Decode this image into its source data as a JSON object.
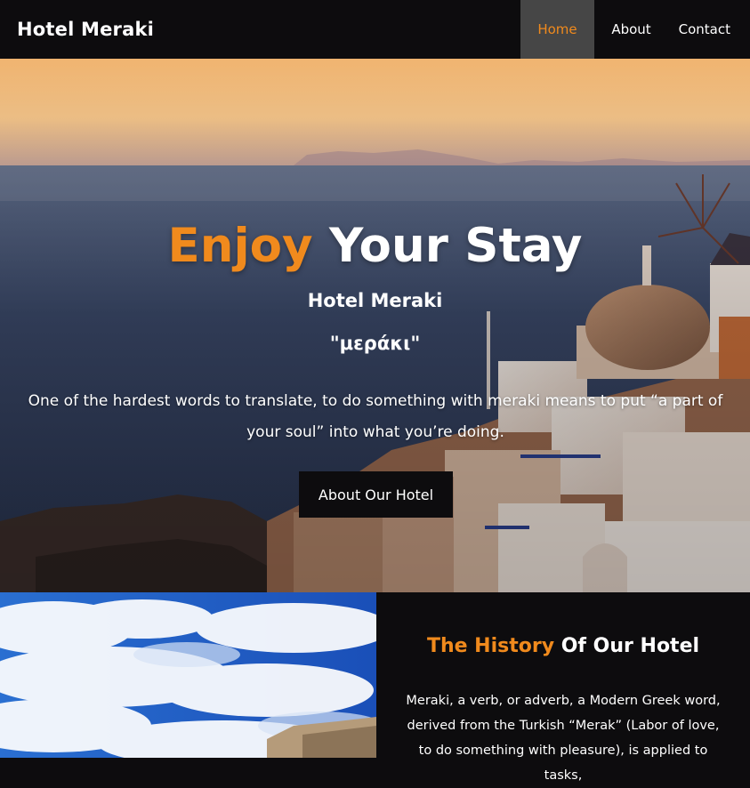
{
  "navbar": {
    "brand": "Hotel Meraki",
    "links": [
      {
        "label": "Home",
        "active": true
      },
      {
        "label": "About",
        "active": false
      },
      {
        "label": "Contact",
        "active": false
      }
    ]
  },
  "hero": {
    "title_accent": "Enjoy",
    "title_rest": " Your Stay",
    "subtitle": "Hotel Meraki",
    "greek": "\"μεράκι\"",
    "text": "One of the hardest words to translate, to do something with meraki means to put “a part of your soul” into what you’re doing.",
    "button_label": "About Our Hotel"
  },
  "history": {
    "title_accent": "The History",
    "title_rest": " Of Our Hotel",
    "text": "Meraki, a verb, or adverb, a Modern Greek word, derived from the Turkish “Merak” (Labor of love, to do something with pleasure), is applied to tasks,"
  },
  "colors": {
    "accent": "#f08a1d",
    "dark": "#0d0c0e",
    "active_nav_bg": "#464646"
  }
}
